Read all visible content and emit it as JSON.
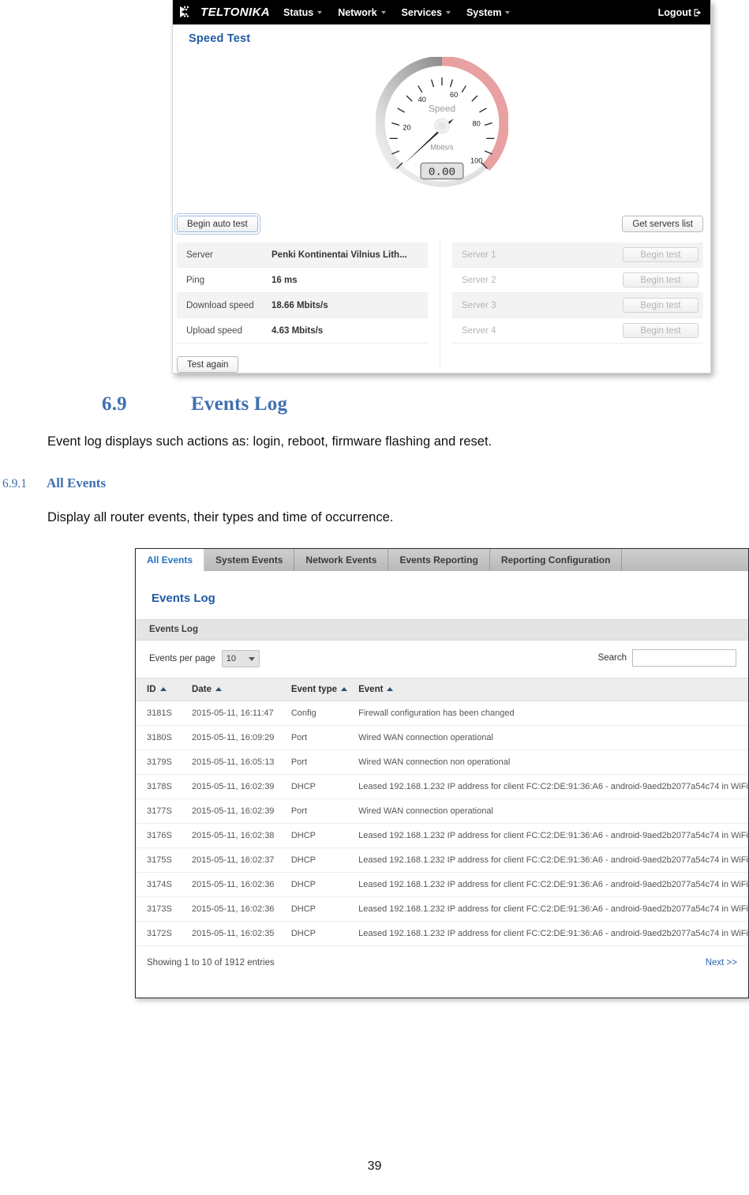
{
  "document": {
    "heading_number": "6.9",
    "heading_title": "Events Log",
    "paragraph_1": "Event log displays such actions as: login, reboot, firmware flashing and reset.",
    "sub_number": "6.9.1",
    "sub_title": "All Events",
    "paragraph_2": "Display all router events, their types and time of occurrence.",
    "page_number": "39"
  },
  "speed_shot": {
    "nav": {
      "brand": "TELTONIKA",
      "items": [
        {
          "label": "Status"
        },
        {
          "label": "Network"
        },
        {
          "label": "Services"
        },
        {
          "label": "System"
        }
      ],
      "logout": "Logout"
    },
    "panel_title": "Speed Test",
    "gauge": {
      "label": "Speed",
      "unit": "Mbits/s",
      "readout": "0.00",
      "value": 0,
      "min": 0,
      "max": 110,
      "ticks": [
        "20",
        "40",
        "60",
        "80",
        "100"
      ]
    },
    "begin_auto_test": "Begin auto test",
    "get_servers_list": "Get servers list",
    "test_again": "Test again",
    "results": [
      {
        "key": "Server",
        "value": "Penki Kontinentai Vilnius Lith..."
      },
      {
        "key": "Ping",
        "value": "16 ms"
      },
      {
        "key": "Download speed",
        "value": "18.66 Mbits/s"
      },
      {
        "key": "Upload speed",
        "value": "4.63 Mbits/s"
      }
    ],
    "servers": [
      {
        "name": "Server 1",
        "button": "Begin test"
      },
      {
        "name": "Server 2",
        "button": "Begin test"
      },
      {
        "name": "Server 3",
        "button": "Begin test"
      },
      {
        "name": "Server 4",
        "button": "Begin test"
      }
    ]
  },
  "events_shot": {
    "tabs": [
      {
        "label": "All Events",
        "active": true
      },
      {
        "label": "System Events",
        "active": false
      },
      {
        "label": "Network Events",
        "active": false
      },
      {
        "label": "Events Reporting",
        "active": false
      },
      {
        "label": "Reporting Configuration",
        "active": false
      }
    ],
    "page_title": "Events Log",
    "section_bar": "Events Log",
    "per_page_label": "Events per page",
    "per_page_value": "10",
    "search_label": "Search",
    "search_value": "",
    "search_placeholder": "",
    "columns": [
      "ID",
      "Date",
      "Event type",
      "Event"
    ],
    "rows": [
      {
        "id": "3181S",
        "date": "2015-05-11, 16:11:47",
        "type": "Config",
        "event": "Firewall configuration has been changed"
      },
      {
        "id": "3180S",
        "date": "2015-05-11, 16:09:29",
        "type": "Port",
        "event": "Wired WAN connection operational"
      },
      {
        "id": "3179S",
        "date": "2015-05-11, 16:05:13",
        "type": "Port",
        "event": "Wired WAN connection non operational"
      },
      {
        "id": "3178S",
        "date": "2015-05-11, 16:02:39",
        "type": "DHCP",
        "event": "Leased 192.168.1.232 IP address for client FC:C2:DE:91:36:A6 - android-9aed2b2077a54c74 in WiFi"
      },
      {
        "id": "3177S",
        "date": "2015-05-11, 16:02:39",
        "type": "Port",
        "event": "Wired WAN connection operational"
      },
      {
        "id": "3176S",
        "date": "2015-05-11, 16:02:38",
        "type": "DHCP",
        "event": "Leased 192.168.1.232 IP address for client FC:C2:DE:91:36:A6 - android-9aed2b2077a54c74 in WiFi"
      },
      {
        "id": "3175S",
        "date": "2015-05-11, 16:02:37",
        "type": "DHCP",
        "event": "Leased 192.168.1.232 IP address for client FC:C2:DE:91:36:A6 - android-9aed2b2077a54c74 in WiFi"
      },
      {
        "id": "3174S",
        "date": "2015-05-11, 16:02:36",
        "type": "DHCP",
        "event": "Leased 192.168.1.232 IP address for client FC:C2:DE:91:36:A6 - android-9aed2b2077a54c74 in WiFi"
      },
      {
        "id": "3173S",
        "date": "2015-05-11, 16:02:36",
        "type": "DHCP",
        "event": "Leased 192.168.1.232 IP address for client FC:C2:DE:91:36:A6 - android-9aed2b2077a54c74 in WiFi"
      },
      {
        "id": "3172S",
        "date": "2015-05-11, 16:02:35",
        "type": "DHCP",
        "event": "Leased 192.168.1.232 IP address for client FC:C2:DE:91:36:A6 - android-9aed2b2077a54c74 in WiFi"
      }
    ],
    "showing": "Showing 1 to 10 of 1912 entries",
    "next": "Next >>"
  },
  "colors": {
    "heading_blue": "#3f6fb0",
    "panel_blue": "#1f5ba6",
    "tab_active_blue": "#2a72c4",
    "nav_black": "#000000",
    "gauge_red": "#e8a0a0"
  }
}
